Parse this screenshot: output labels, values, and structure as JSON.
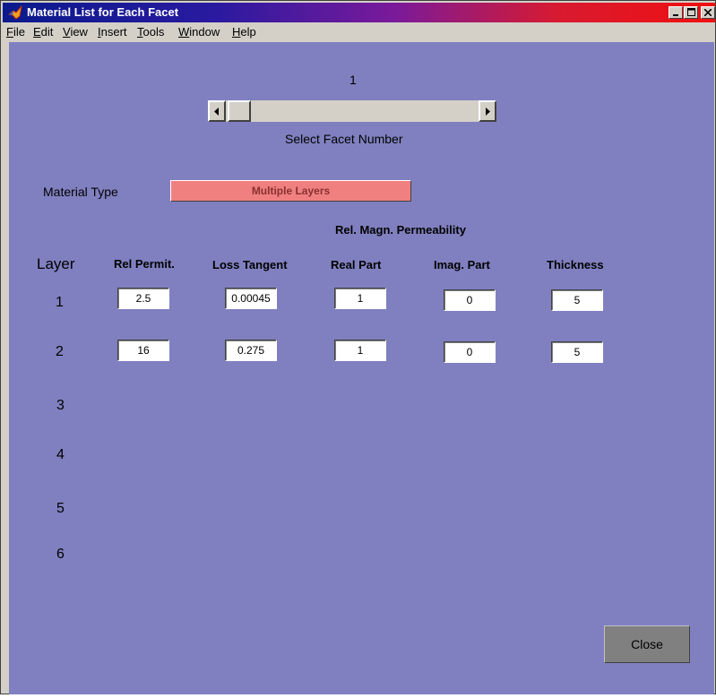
{
  "window": {
    "title": "Material List for Each Facet"
  },
  "menu": [
    {
      "label": "File",
      "key": "F"
    },
    {
      "label": "Edit",
      "key": "E"
    },
    {
      "label": "View",
      "key": "V"
    },
    {
      "label": "Insert",
      "key": "I"
    },
    {
      "label": "Tools",
      "key": "T"
    },
    {
      "label": "Window",
      "key": "W"
    },
    {
      "label": "Help",
      "key": "H"
    }
  ],
  "facet": {
    "number": "1",
    "label": "Select Facet Number",
    "slider_fraction": 0.0
  },
  "material": {
    "label": "Material Type",
    "value": "Multiple Layers"
  },
  "table": {
    "group_header": "Rel. Magn. Permeability",
    "layer_header": "Layer",
    "headers": [
      "Rel Permit.",
      "Loss Tangent",
      "Real Part",
      "Imag. Part",
      "Thickness"
    ],
    "layer_numbers": [
      "1",
      "2",
      "3",
      "4",
      "5",
      "6"
    ],
    "rows": [
      [
        "2.5",
        "0.00045",
        "1",
        "0",
        "5"
      ],
      [
        "16",
        "0.275",
        "1",
        "0",
        "5"
      ]
    ]
  },
  "close_label": "Close",
  "colors": {
    "background": "#8080c0",
    "material_field": "#f08080",
    "title_left": "#0a1a8c",
    "title_right": "#f01010"
  }
}
